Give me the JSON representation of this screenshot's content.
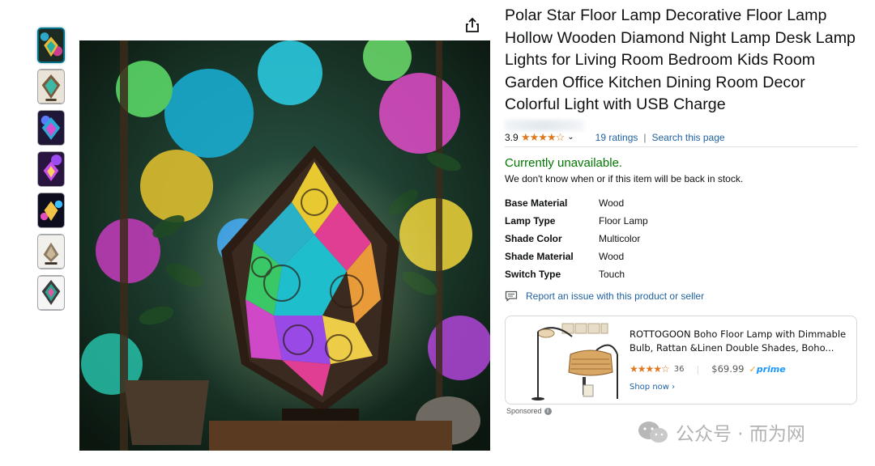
{
  "thumbnails": [
    {
      "name": "thumbnail-1",
      "selected": true
    },
    {
      "name": "thumbnail-2",
      "selected": false
    },
    {
      "name": "thumbnail-3",
      "selected": false
    },
    {
      "name": "thumbnail-4",
      "selected": false
    },
    {
      "name": "thumbnail-5",
      "selected": false
    },
    {
      "name": "thumbnail-6",
      "selected": false
    },
    {
      "name": "thumbnail-7",
      "selected": false
    }
  ],
  "share_icon": "share-icon",
  "product": {
    "title": "Polar Star Floor Lamp Decorative Floor Lamp Hollow Wooden Diamond Night Lamp Desk Lamp Lights for Living Room Bedroom Kids Room Garden Office Kitchen Dining Room Decor Colorful Light with USB Charge",
    "rating_value": "3.9",
    "stars": "★★★★☆",
    "ratings_link": "19 ratings",
    "search_link": "Search this page"
  },
  "availability": {
    "status": "Currently unavailable.",
    "message": "We don't know when or if this item will be back in stock.",
    "status_color": "#007600"
  },
  "specs": [
    {
      "key": "Base Material",
      "value": "Wood"
    },
    {
      "key": "Lamp Type",
      "value": "Floor Lamp"
    },
    {
      "key": "Shade Color",
      "value": "Multicolor"
    },
    {
      "key": "Shade Material",
      "value": "Wood"
    },
    {
      "key": "Switch Type",
      "value": "Touch"
    }
  ],
  "report": {
    "label": "Report an issue with this product or seller"
  },
  "ad": {
    "title": "ROTTOGOON Boho Floor Lamp with Dimmable Bulb, Rattan &Linen Double Shades, Boho...",
    "stars": "★★★★☆",
    "rating_count": "36",
    "price": "$69.99",
    "prime": "prime",
    "shop_now": "Shop now ›",
    "sponsored_label": "Sponsored"
  },
  "watermark": {
    "text": "公众号 · 而为网"
  },
  "colors": {
    "link": "#2162a1",
    "star": "#de7921",
    "selected_thumb": "#007185"
  }
}
